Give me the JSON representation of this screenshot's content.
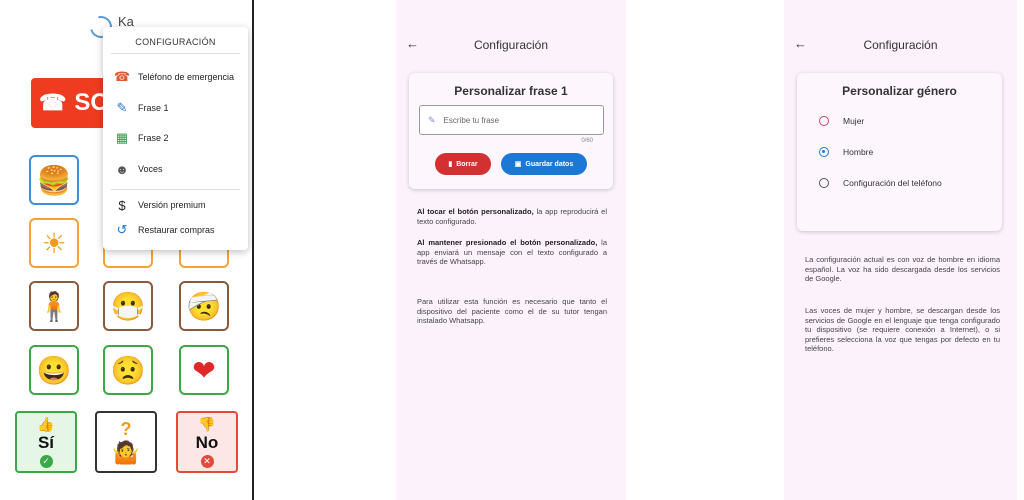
{
  "screen1": {
    "app_title": "Ka",
    "sos_label": "SO",
    "menu": {
      "title": "CONFIGURACIÓN",
      "items": [
        {
          "label": "Teléfono de emergencia",
          "icon": "phone-forward-icon",
          "glyph": "☎",
          "color": "#e2562f"
        },
        {
          "label": "Frase 1",
          "icon": "edit-text-icon",
          "glyph": "✎",
          "color": "#1c78d6"
        },
        {
          "label": "Frase 2",
          "icon": "calendar-edit-icon",
          "glyph": "▦",
          "color": "#2e9a3d"
        },
        {
          "label": "Voces",
          "icon": "voice-person-icon",
          "glyph": "☻",
          "color": "#555555"
        },
        {
          "label": "Versión premium",
          "icon": "dollar-icon",
          "glyph": "$",
          "color": "#222222"
        },
        {
          "label": "Restaurar compras",
          "icon": "restore-icon",
          "glyph": "↺",
          "color": "#1c78d6"
        }
      ]
    },
    "tiles": [
      {
        "name": "tile-eat",
        "glyph": "🍔",
        "cls": "t-blue"
      },
      {
        "name": "tile-hot",
        "glyph": "☀",
        "cls": "t-orange"
      },
      {
        "name": "tile-back-pain",
        "glyph": "🧍",
        "cls": "t-brown"
      },
      {
        "name": "tile-sick",
        "glyph": "😷",
        "cls": "t-brown"
      },
      {
        "name": "tile-headache",
        "glyph": "🤕",
        "cls": "t-brown"
      },
      {
        "name": "tile-happy",
        "glyph": "😀",
        "cls": "t-green"
      },
      {
        "name": "tile-sad",
        "glyph": "😟",
        "cls": "t-green"
      },
      {
        "name": "tile-love",
        "glyph": "❤",
        "cls": "t-green"
      }
    ],
    "yes_label": "Sí",
    "no_label": "No",
    "question_glyph": "?"
  },
  "screen2": {
    "title": "Configuración",
    "card_title": "Personalizar frase 1",
    "input_placeholder": "Escribe tu frase",
    "counter": "0/60",
    "delete_label": "Borrar",
    "save_label": "Guardar datos",
    "p1_bold": "Al tocar el botón personalizado,",
    "p1_rest": " la app reproducirá el texto configurado.",
    "p2_bold": "Al mantener presionado el botón personalizado,",
    "p2_rest": " la app enviará un mensaje con el texto configurado a través de Whatsapp.",
    "p3": "Para utilizar esta función es necesario que tanto el dispositivo del paciente como el de su tutor tengan instalado Whatsapp."
  },
  "screen3": {
    "title": "Configuración",
    "card_title": "Personalizar género",
    "options": [
      {
        "label": "Mujer",
        "state": "pink"
      },
      {
        "label": "Hombre",
        "state": "selected"
      },
      {
        "label": "Configuración del teléfono",
        "state": "default"
      }
    ],
    "p1": "La configuración actual es con voz de hombre en idioma español. La voz ha sido descargada desde los servicios de Google.",
    "p2": "Las voces de mujer y hombre, se descargan desde los servicios de Google en el lenguaje que tenga configurado tu dispositivo (se requiere conexión a Internet), o si prefieres selecciona la voz que tengas por defecto en tu teléfono."
  }
}
